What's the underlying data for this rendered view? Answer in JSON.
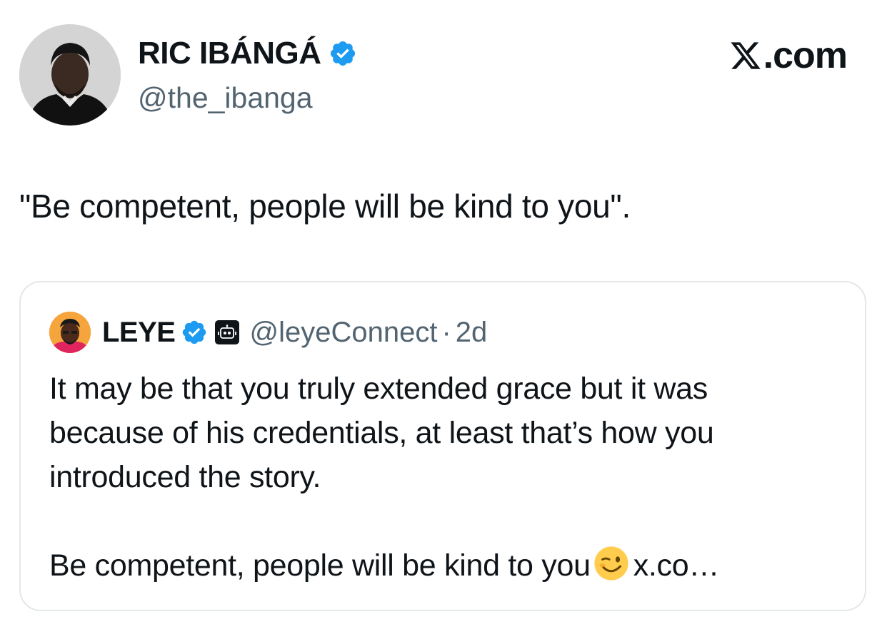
{
  "author": {
    "name": "RIC IBÁNGÁ",
    "handle": "@the_ibanga",
    "verified": true,
    "avatar": "avatar-photo"
  },
  "brand": {
    "logo_text": ".com",
    "logo_icon": "x-logo-icon"
  },
  "tweet": {
    "text": "\"Be competent, people will be kind to you\"."
  },
  "quote": {
    "name": "LEYE",
    "handle": "@leyeConnect",
    "separator": "·",
    "time": "2d",
    "verified": true,
    "affiliation_icon": "robot-badge-icon",
    "lines": [
      "It may be that you truly extended grace but it was",
      "because of his credentials, at least that’s how you",
      "introduced the story."
    ],
    "last_line_before_emoji": "Be competent, people will be kind to you",
    "last_line_after_emoji": "x.co…",
    "emoji": "winking-face"
  },
  "colors": {
    "text": "#0f1419",
    "secondary": "#536471",
    "verified": "#1d9bf0",
    "border": "#e4e7ea"
  }
}
